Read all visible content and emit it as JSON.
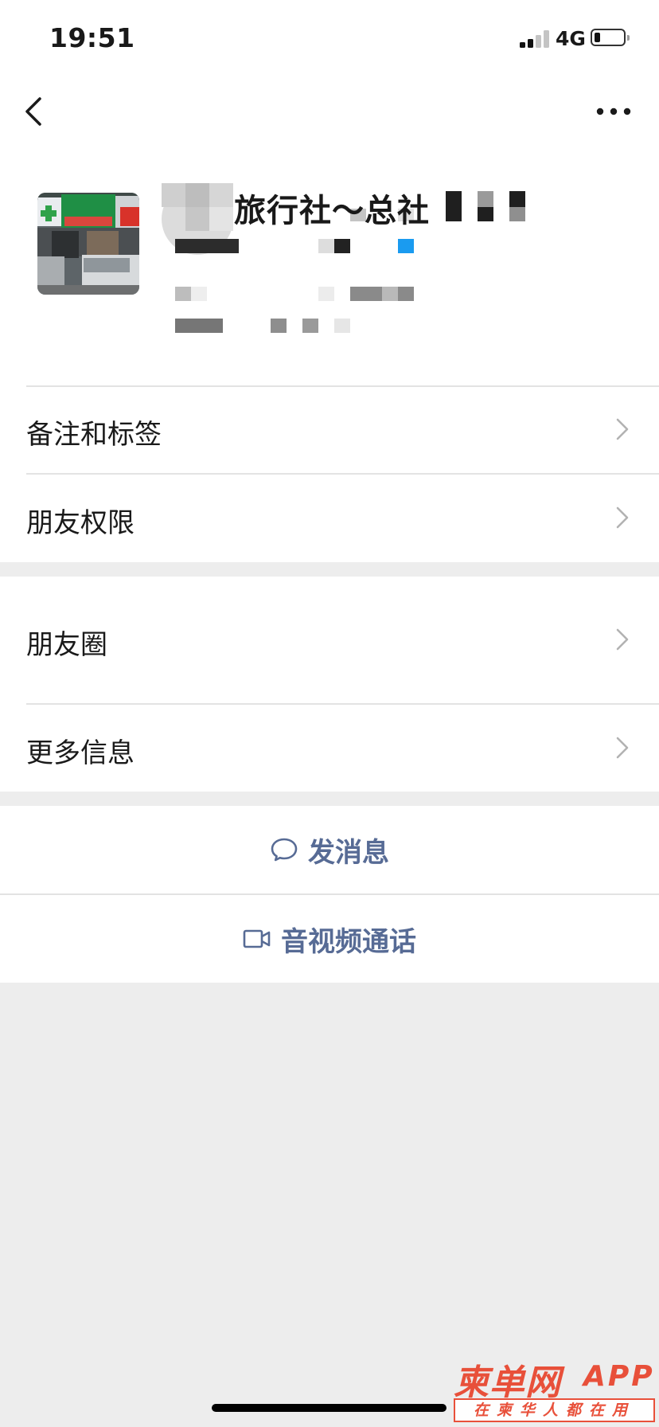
{
  "status_bar": {
    "time": "19:51",
    "network": "4G",
    "signal_bars_active": 2,
    "signal_bars_total": 4,
    "battery_level": 0.15
  },
  "nav": {
    "back_icon": "chevron-left-icon",
    "more_icon": "ellipsis-icon"
  },
  "profile": {
    "name": "旅行社～总社"
  },
  "menu": [
    {
      "label": "备注和标签",
      "icon": "chevron-right-icon"
    },
    {
      "label": "朋友权限",
      "icon": "chevron-right-icon"
    },
    {
      "label": "朋友圈",
      "icon": "chevron-right-icon"
    },
    {
      "label": "更多信息",
      "icon": "chevron-right-icon"
    }
  ],
  "actions": {
    "message": {
      "label": "发消息",
      "icon": "chat-bubble-icon"
    },
    "call": {
      "label": "音视频通话",
      "icon": "video-camera-icon"
    }
  },
  "watermark": {
    "brand": "柬单网",
    "suffix": "APP",
    "tagline": "在柬华人都在用"
  },
  "colors": {
    "action_text": "#576b95",
    "background": "#ededed",
    "watermark": "#e8503a"
  }
}
